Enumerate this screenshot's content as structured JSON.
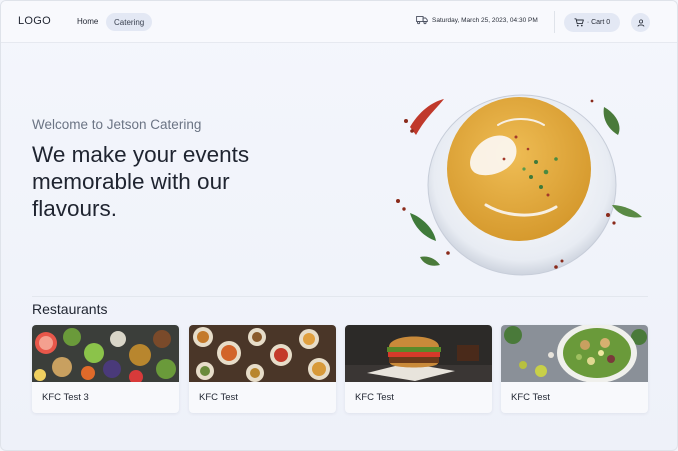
{
  "header": {
    "logo": "LOGO",
    "nav": {
      "home": "Home",
      "catering": "Catering"
    },
    "datetime": "Saturday, March 25, 2023, 04:30 PM",
    "cart_label": "· Cart 0"
  },
  "hero": {
    "subtitle": "Welcome to Jetson Catering",
    "title": "We make your events memorable with our flavours.",
    "image_icon": "soup-bowl-image"
  },
  "restaurants": {
    "title": "Restaurants",
    "items": [
      {
        "name": "KFC Test 3"
      },
      {
        "name": "KFC Test"
      },
      {
        "name": "KFC Test"
      },
      {
        "name": "KFC Test"
      }
    ]
  },
  "colors": {
    "background": "#f3f5fb",
    "pill": "#e3e8f4",
    "text": "#1f2430",
    "muted": "#6b7484",
    "soup": "#e2a93b"
  }
}
